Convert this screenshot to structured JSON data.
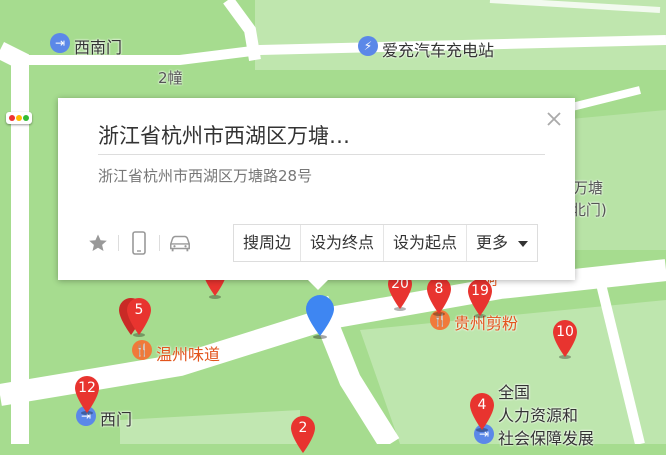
{
  "map": {
    "labels": {
      "xinanmen": "西南门",
      "charger": "爱充汽车充电站",
      "building2": "2幢",
      "wantang_side": "万塘",
      "north_gate": "(北门)",
      "wenzhou": "温州味道",
      "guizhou": "贵州剪粉",
      "ximen": "西门",
      "guoren_partial": "东阿",
      "ministry_line1": "全国",
      "ministry_line2": "人力资源和",
      "ministry_line3": "社会保障发展"
    },
    "markers": [
      "20",
      "8",
      "19",
      "5",
      "10",
      "12",
      "4",
      "2"
    ]
  },
  "popup": {
    "title": "浙江省杭州市西湖区万塘…",
    "address": "浙江省杭州市西湖区万塘路28号",
    "actions": {
      "nearby": "搜周边",
      "set_end": "设为终点",
      "set_start": "设为起点",
      "more": "更多"
    }
  },
  "colors": {
    "map_green": "#a6dc8f",
    "road": "#ffffff",
    "marker_red": "#e8342f",
    "location_pin": "#3e86f2"
  }
}
